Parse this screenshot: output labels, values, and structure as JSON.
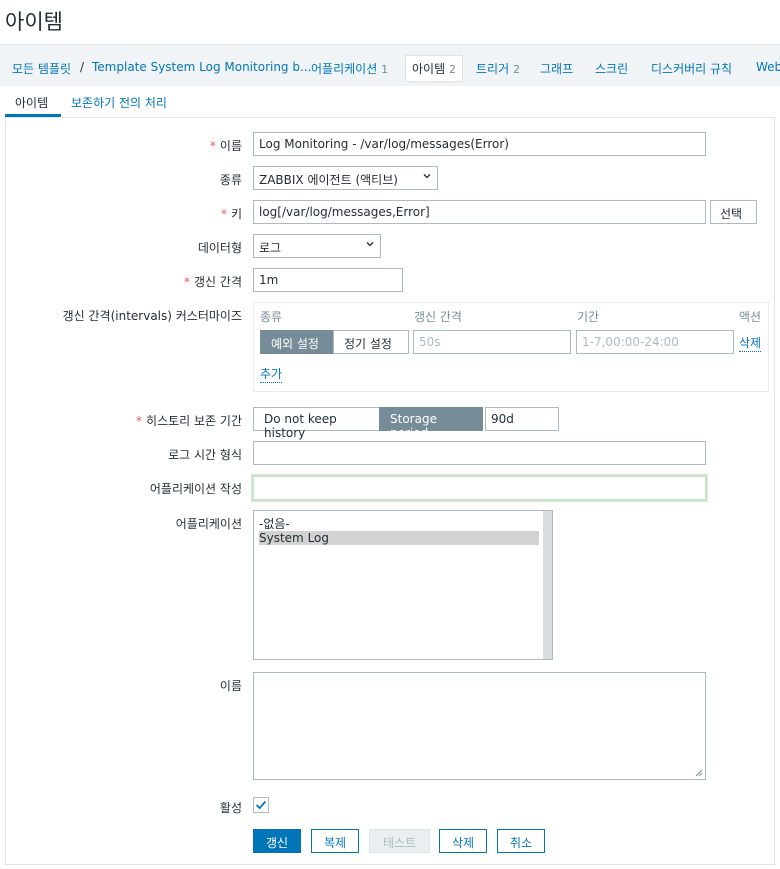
{
  "page": {
    "title": "아이템"
  },
  "breadcrumb": {
    "all_templates": "모든 템플릿",
    "separator": "/",
    "template": "Template System Log Monitoring b...",
    "tabs": [
      {
        "label": "어플리케이션",
        "count": "1"
      },
      {
        "label": "아이템",
        "count": "2"
      },
      {
        "label": "트리거",
        "count": "2"
      },
      {
        "label": "그래프",
        "count": ""
      },
      {
        "label": "스크린",
        "count": ""
      },
      {
        "label": "디스커버리 규칙",
        "count": ""
      },
      {
        "label": "Web",
        "count": ""
      }
    ]
  },
  "subtabs": {
    "item": "아이템",
    "preprocessing": "보존하기 전의 처리"
  },
  "form": {
    "required_mark": "*",
    "name": {
      "label": "이름",
      "value": "Log Monitoring - /var/log/messages(Error)"
    },
    "type": {
      "label": "종류",
      "value": "ZABBIX 에이전트 (액티브)"
    },
    "key": {
      "label": "키",
      "value": "log[/var/log/messages,Error]",
      "select_button": "선택"
    },
    "data_type": {
      "label": "데이터형",
      "value": "로그"
    },
    "update_interval": {
      "label": "갱신 간격",
      "value": "1m"
    },
    "custom_intervals": {
      "label": "갱신 간격(intervals) 커스터마이즈",
      "col_type": "종류",
      "col_interval": "갱신 간격",
      "col_period": "기간",
      "col_action": "액션",
      "seg_flexible": "예외 설정",
      "seg_scheduling": "정기 설정",
      "interval_placeholder": "50s",
      "period_placeholder": "1-7,00:00-24:00",
      "remove": "삭제",
      "add": "추가"
    },
    "history": {
      "label": "히스토리 보존 기간",
      "do_not_keep": "Do not keep history",
      "storage_period": "Storage period",
      "value": "90d"
    },
    "log_time_format": {
      "label": "로그 시간 형식",
      "value": ""
    },
    "new_application": {
      "label": "어플리케이션 작성",
      "value": ""
    },
    "applications": {
      "label": "어플리케이션",
      "options": [
        "-없음-",
        "System Log"
      ],
      "selected": "System Log"
    },
    "description": {
      "label": "이름",
      "value": ""
    },
    "enabled": {
      "label": "활성",
      "checked": true
    }
  },
  "actions": {
    "update": "갱신",
    "clone": "복제",
    "test": "테스트",
    "delete": "삭제",
    "cancel": "취소"
  }
}
